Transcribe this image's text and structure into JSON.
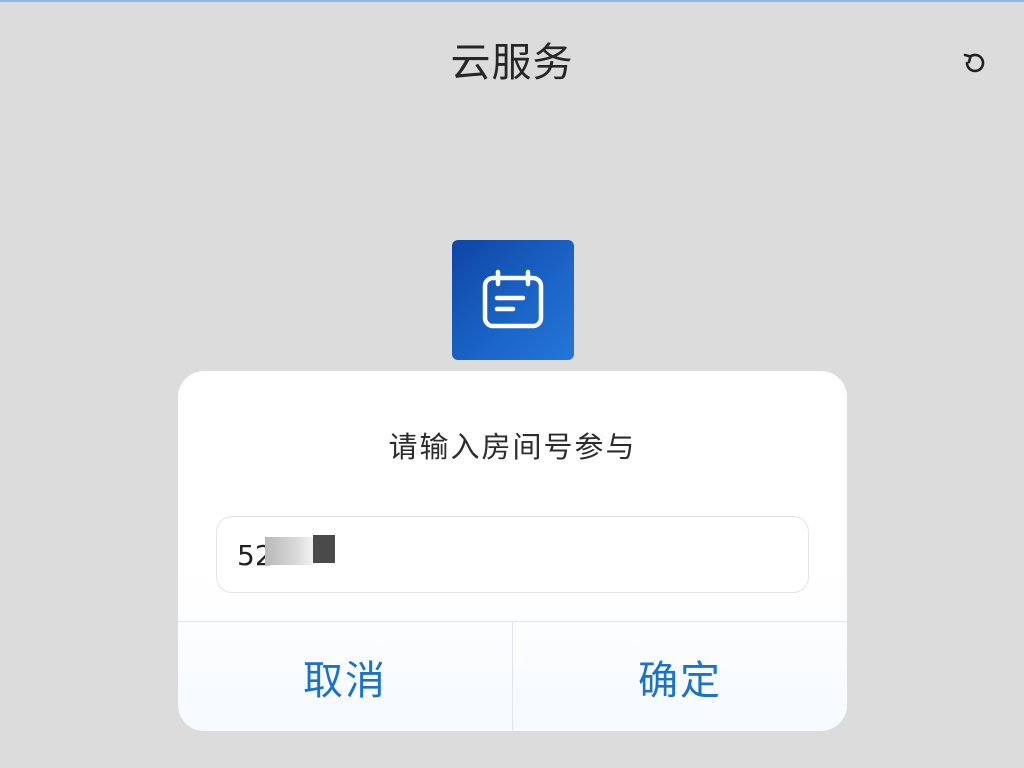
{
  "header": {
    "title": "云服务",
    "refresh_icon": "refresh-icon"
  },
  "app_icon": {
    "icon": "calendar-icon",
    "colors": {
      "background": "#1558b8",
      "glyph": "#ffffff"
    }
  },
  "dialog": {
    "title": "请输入房间号参与",
    "input": {
      "value": "52",
      "masked": true
    },
    "buttons": {
      "cancel": "取消",
      "confirm": "确定"
    }
  },
  "colors": {
    "page_background": "#dcdcdc",
    "accent": "#1a73c8",
    "dialog_background": "#ffffff"
  }
}
